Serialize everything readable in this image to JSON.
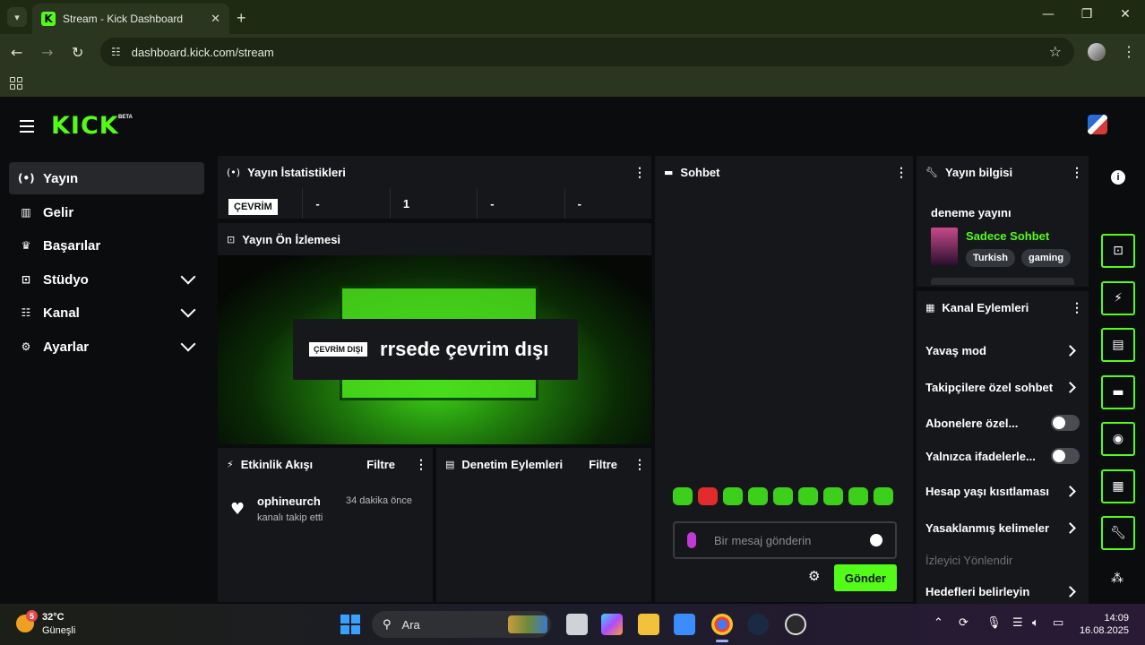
{
  "browser": {
    "tab_title": "Stream - Kick Dashboard",
    "tab_favicon": "K",
    "url": "dashboard.kick.com/stream"
  },
  "header": {
    "logo": "KICK",
    "logo_badge": "BETA"
  },
  "sidebar": {
    "items": [
      {
        "label": "Yayın",
        "icon": "broadcast-icon",
        "glyph": "(•)"
      },
      {
        "label": "Gelir",
        "icon": "chart-icon",
        "glyph": "▥"
      },
      {
        "label": "Başarılar",
        "icon": "trophy-icon",
        "glyph": "♛"
      },
      {
        "label": "Stüdyo",
        "icon": "studio-icon",
        "glyph": "⊡"
      },
      {
        "label": "Kanal",
        "icon": "channel-icon",
        "glyph": "☷"
      },
      {
        "label": "Ayarlar",
        "icon": "gear-icon",
        "glyph": "⚙"
      }
    ]
  },
  "stats": {
    "title": "Yayın İstatistikleri",
    "live_badge": "ÇEVRİM",
    "values": [
      "-",
      "1",
      "-",
      "-"
    ]
  },
  "preview": {
    "title": "Yayın Ön İzlemesi",
    "offline_badge": "ÇEVRİM DIŞI",
    "offline_text": "rrsede çevrim dışı"
  },
  "activity": {
    "title": "Etkinlik Akışı",
    "filter": "Filtre",
    "item": {
      "user": "ophineurch",
      "desc": "kanalı takip etti",
      "time": "34 dakika önce"
    }
  },
  "moderation": {
    "title": "Denetim Eylemleri",
    "filter": "Filtre"
  },
  "chat": {
    "title": "Sohbet",
    "placeholder": "Bir mesaj gönderin",
    "send": "Gönder"
  },
  "stream_info": {
    "title": "Yayın bilgisi",
    "stream_title": "deneme yayını",
    "category": "Sadece Sohbet",
    "tags": [
      "Turkish",
      "gaming"
    ]
  },
  "channel_actions": {
    "title": "Kanal Eylemleri",
    "items": [
      {
        "label": "Yavaş mod",
        "control": "chevron"
      },
      {
        "label": "Takipçilere özel sohbet",
        "control": "chevron"
      },
      {
        "label": "Abonelere özel...",
        "control": "toggle",
        "on": false
      },
      {
        "label": "Yalnızca ifadelerle...",
        "control": "toggle",
        "on": false
      },
      {
        "label": "Hesap yaşı kısıtlaması",
        "control": "chevron"
      },
      {
        "label": "Yasaklanmış kelimeler",
        "control": "chevron"
      },
      {
        "label": "İzleyici Yönlendir",
        "control": "none",
        "disabled": true
      },
      {
        "label": "Hedefleri belirleyin",
        "control": "chevron"
      }
    ]
  },
  "taskbar": {
    "weather_temp": "32°C",
    "weather_desc": "Güneşli",
    "weather_badge": "5",
    "search": "Ara",
    "time": "14:09",
    "date": "16.08.2025"
  },
  "colors": {
    "accent": "#53fc18",
    "panel": "#16171a",
    "background": "#0b0c0e"
  }
}
